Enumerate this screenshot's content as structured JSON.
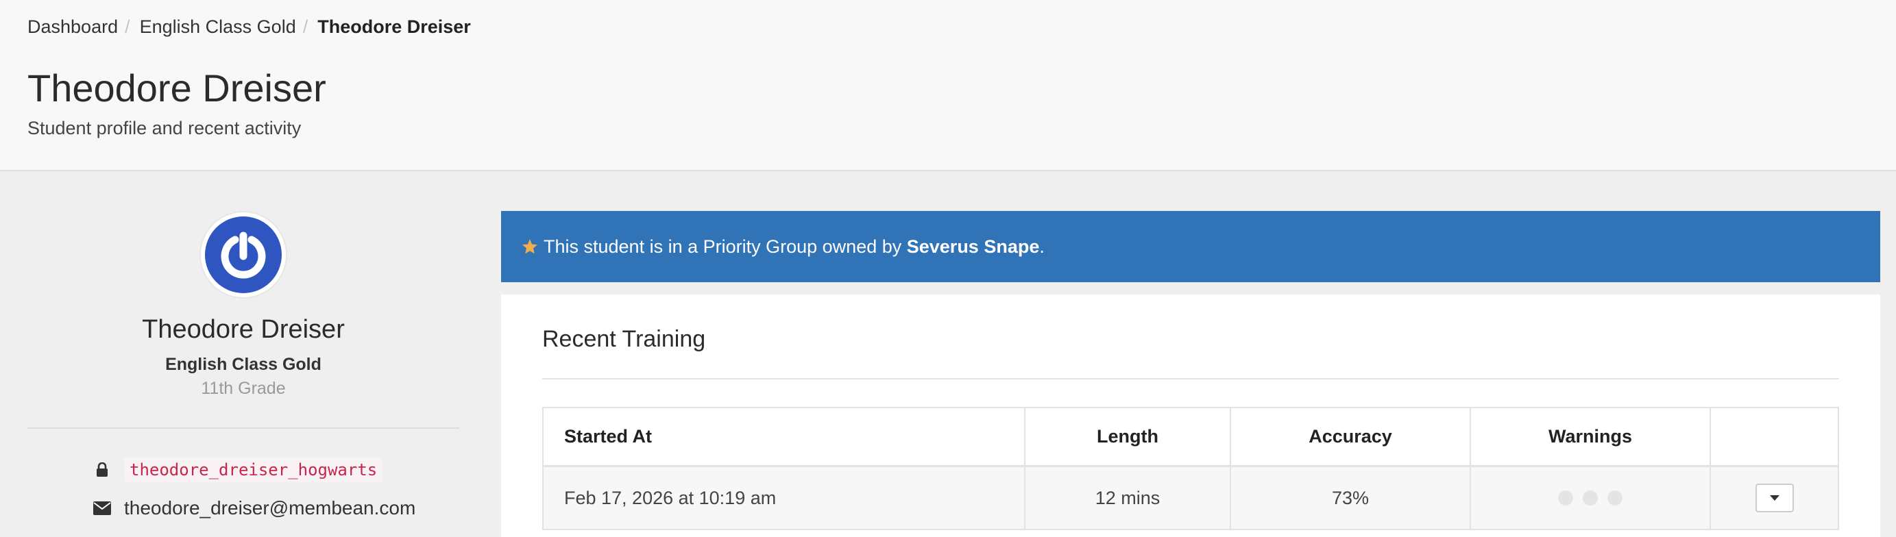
{
  "breadcrumb": {
    "items": [
      "Dashboard",
      "English Class Gold"
    ],
    "current": "Theodore Dreiser",
    "separator": "/"
  },
  "header": {
    "title": "Theodore Dreiser",
    "subtitle": "Student profile and recent activity"
  },
  "profile": {
    "name": "Theodore Dreiser",
    "class_name": "English Class Gold",
    "grade": "11th Grade",
    "username": "theodore_dreiser_hogwarts",
    "email": "theodore_dreiser@membean.com",
    "avatar_icon": "power-icon",
    "avatar_color": "#2f55c0"
  },
  "alert": {
    "prefix": "This student is in a Priority Group owned by ",
    "owner": "Severus Snape",
    "suffix": ".",
    "icon": "star-icon",
    "background": "#3173b7",
    "star_color": "#f0ad4e"
  },
  "training": {
    "title": "Recent Training",
    "columns": [
      "Started At",
      "Length",
      "Accuracy",
      "Warnings",
      ""
    ],
    "rows": [
      {
        "started_at": "Feb 17, 2026 at 10:19 am",
        "length": "12 mins",
        "accuracy": "73%",
        "warnings": 0
      }
    ]
  }
}
